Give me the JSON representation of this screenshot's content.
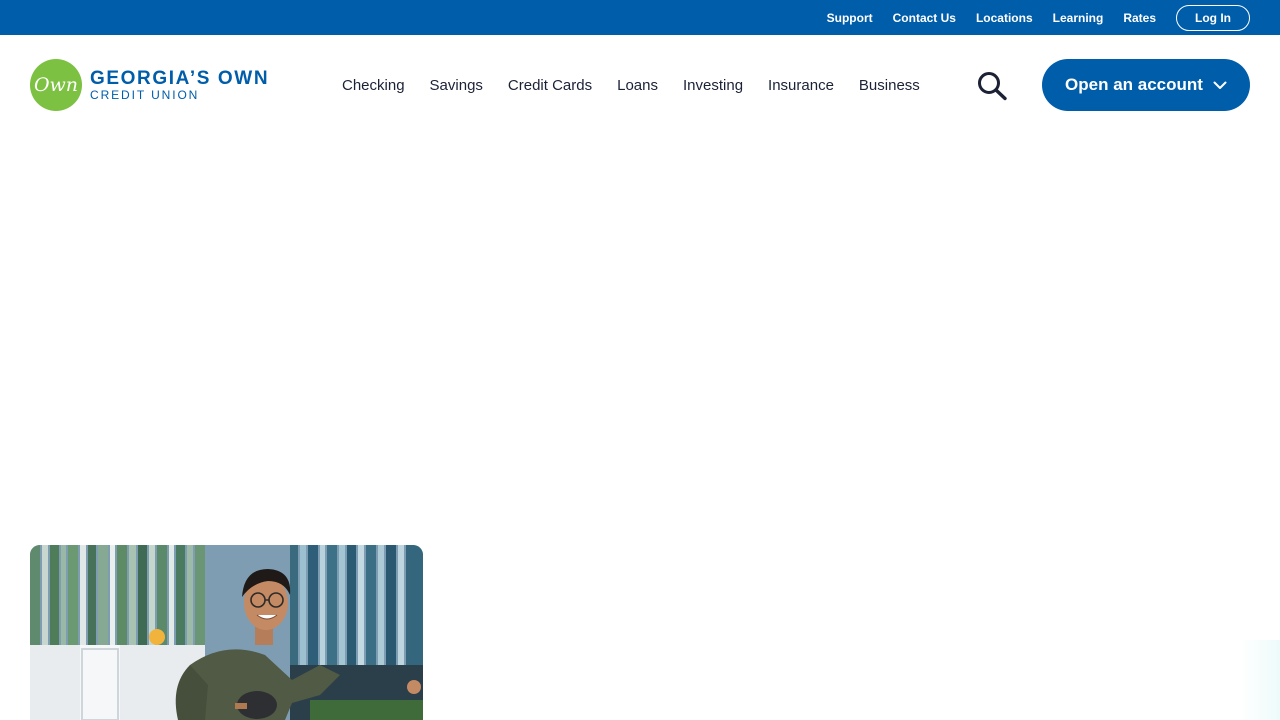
{
  "utility_nav": {
    "links": [
      "Support",
      "Contact Us",
      "Locations",
      "Learning",
      "Rates"
    ],
    "login_label": "Log In"
  },
  "brand": {
    "logo_mark": "Own",
    "name_line1": "GEORGIA’S OWN",
    "name_line2": "CREDIT UNION",
    "primary_color": "#005daa",
    "accent_color": "#7cc142"
  },
  "main_nav": {
    "items": [
      "Checking",
      "Savings",
      "Credit Cards",
      "Loans",
      "Investing",
      "Insurance",
      "Business"
    ]
  },
  "search": {
    "icon": "search-icon"
  },
  "cta": {
    "label": "Open an account",
    "icon": "chevron-down-icon"
  },
  "promo": {
    "image": "person-playing-ping-pong-photo"
  }
}
